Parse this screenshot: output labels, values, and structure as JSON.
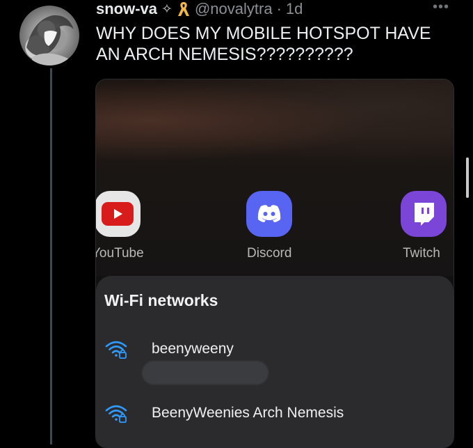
{
  "tweet": {
    "author_name": "snow-va",
    "sparkle_icon": "sparkle-icon",
    "ribbon_icon": "awareness-ribbon-icon",
    "handle": "@novalytra",
    "separator": "·",
    "time": "1d",
    "more_icon": "more-horizontal-icon",
    "text": "WHY DOES MY MOBILE HOTSPOT HAVE AN ARCH NEMESIS??????????"
  },
  "screenshot": {
    "apps": [
      {
        "label": "YouTube",
        "icon": "youtube-icon",
        "color": "#e21b1b"
      },
      {
        "label": "Discord",
        "icon": "discord-icon",
        "color": "#5865f2"
      },
      {
        "label": "Twitch",
        "icon": "twitch-icon",
        "color": "#7b45d8"
      }
    ],
    "wifi": {
      "title": "Wi-Fi networks",
      "networks": [
        {
          "name": "beenyweeny",
          "icon": "wifi-lock-icon"
        },
        {
          "name": "BeenyWeenies Arch Nemesis",
          "icon": "wifi-lock-icon"
        }
      ]
    }
  },
  "colors": {
    "background": "#000000",
    "accent_icon": "#2f9bff",
    "panel": "#2b2b2d"
  }
}
